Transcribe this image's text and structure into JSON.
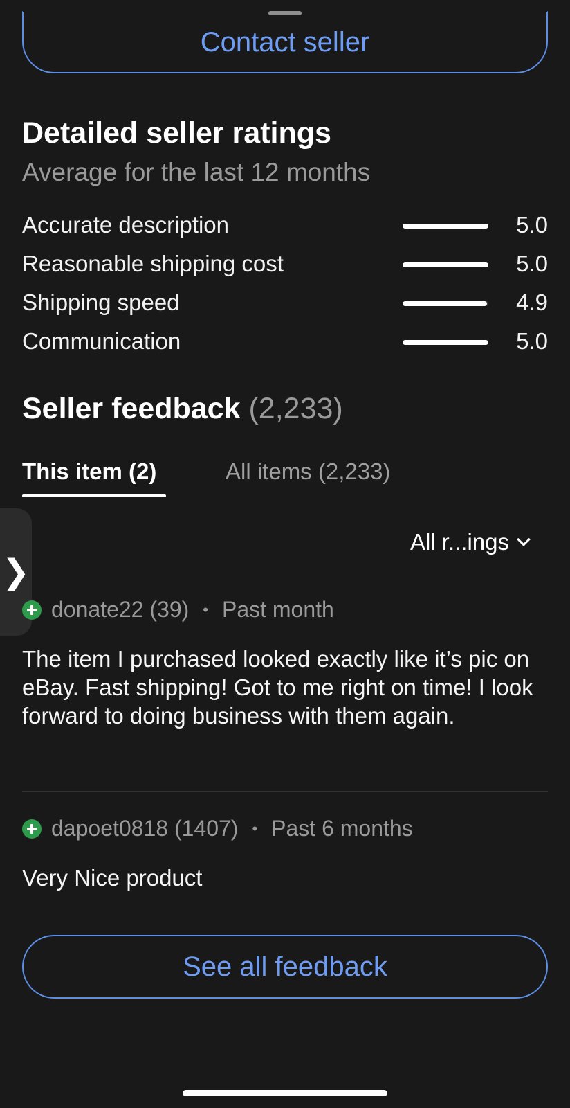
{
  "contact_button": "Contact seller",
  "ratings": {
    "title": "Detailed seller ratings",
    "subtitle": "Average for the last 12 months",
    "items": [
      {
        "label": "Accurate description",
        "value": "5.0",
        "fill": 1.0
      },
      {
        "label": "Reasonable shipping cost",
        "value": "5.0",
        "fill": 1.0
      },
      {
        "label": "Shipping speed",
        "value": "4.9",
        "fill": 0.98
      },
      {
        "label": "Communication",
        "value": "5.0",
        "fill": 1.0
      }
    ]
  },
  "feedback": {
    "title": "Seller feedback",
    "count": "(2,233)",
    "tabs": [
      {
        "label": "This item (2)",
        "active": true
      },
      {
        "label": "All items (2,233)",
        "active": false
      }
    ],
    "filter_label": "All r...ings",
    "reviews": [
      {
        "user": "donate22 (39)",
        "time": "Past month",
        "text": "The item I purchased looked exactly like it’s pic on eBay. Fast shipping! Got to me right on time! I look forward to doing business with them again."
      },
      {
        "user": "dapoet0818 (1407)",
        "time": "Past 6 months",
        "text": "Very Nice product"
      }
    ],
    "see_all": "See all feedback"
  },
  "side_handle_glyph": "❯",
  "icons": {
    "positive": "plus-circle-icon",
    "dropdown": "chevron-down-icon",
    "side": "chevron-right-icon"
  },
  "colors": {
    "background": "#191919",
    "accent": "#6f9cf3",
    "positive": "#2e9a4b"
  }
}
